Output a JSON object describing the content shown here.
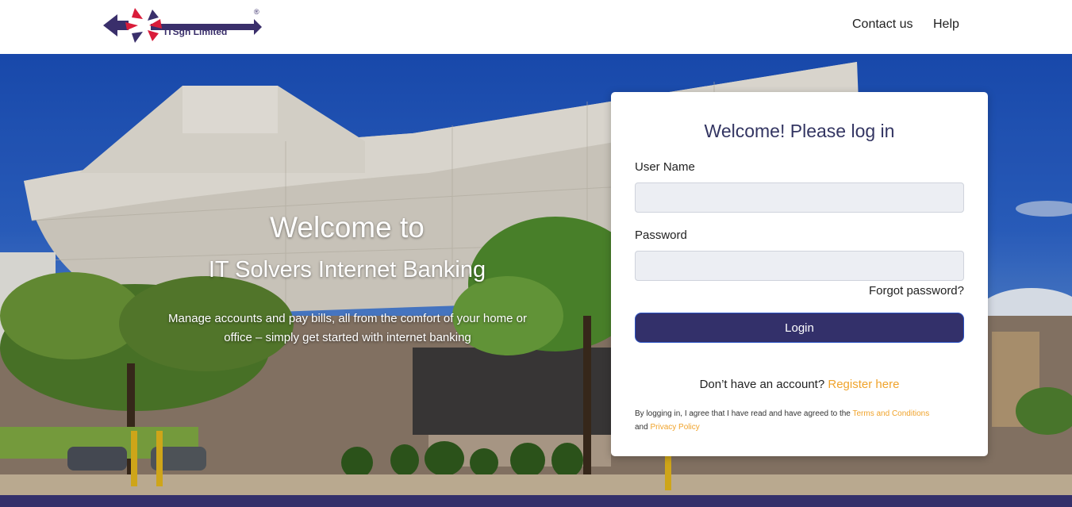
{
  "header": {
    "logo_text": "ITSgh Limited",
    "logo_reg": "®",
    "nav": {
      "contact": "Contact us",
      "help": "Help"
    }
  },
  "hero": {
    "welcome": "Welcome to",
    "bank_name": "IT Solvers Internet Banking",
    "subtitle": "Manage accounts and pay bills, all from the comfort of your home or office – simply get started with internet banking"
  },
  "login": {
    "title": "Welcome! Please log in",
    "username_label": "User Name",
    "username_value": "",
    "password_label": "Password",
    "password_value": "",
    "forgot": "Forgot password?",
    "login_button": "Login",
    "no_account": "Don’t have an account?",
    "register": "Register here",
    "agree_prefix": "By logging in, I agree that I have read and have agreed to the",
    "terms": "Terms and Conditions",
    "and": "and",
    "privacy": "Privacy Policy"
  },
  "colors": {
    "brand": "#33306a",
    "accent": "#f0a32b",
    "sky": "#1b4fb9"
  },
  "icons": {
    "logo": "itsgh-logo-arrows-icon"
  }
}
